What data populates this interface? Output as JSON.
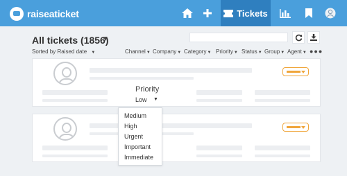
{
  "app": {
    "logo_text": "raiseaticket"
  },
  "nav": {
    "active_label": "Tickets"
  },
  "header": {
    "title": "All tickets (1856)",
    "sort_label": "Sorted by Raised date"
  },
  "filters": [
    "Channel",
    "Company",
    "Category",
    "Priority",
    "Status",
    "Group",
    "Agent"
  ],
  "priority": {
    "label": "Priority",
    "value": "Low",
    "options": [
      "Medium",
      "High",
      "Urgent",
      "Important",
      "Immediate"
    ]
  },
  "colors": {
    "brand": "#4a9fdc",
    "brand_dark": "#2f7fbf",
    "badge": "#f0a53a"
  },
  "icons": [
    "home-icon",
    "plus-icon",
    "tickets-icon",
    "chart-icon",
    "bookmark-icon",
    "user-avatar-icon",
    "refresh-icon",
    "download-icon",
    "more-icon"
  ]
}
